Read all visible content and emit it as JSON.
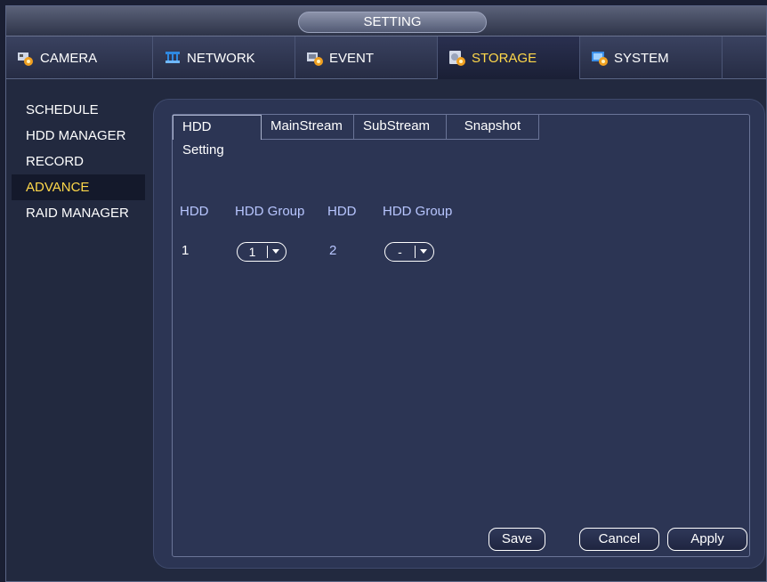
{
  "window": {
    "title": "SETTING"
  },
  "main_tabs": [
    {
      "label": "CAMERA",
      "icon": "camera-gear-icon"
    },
    {
      "label": "NETWORK",
      "icon": "network-icon"
    },
    {
      "label": "EVENT",
      "icon": "event-gear-icon"
    },
    {
      "label": "STORAGE",
      "icon": "storage-gear-icon",
      "active": true
    },
    {
      "label": "SYSTEM",
      "icon": "system-gear-icon"
    }
  ],
  "sidebar": {
    "items": [
      {
        "label": "SCHEDULE"
      },
      {
        "label": "HDD MANAGER"
      },
      {
        "label": "RECORD"
      },
      {
        "label": "ADVANCE",
        "active": true
      },
      {
        "label": "RAID MANAGER"
      }
    ]
  },
  "sub_tabs": [
    {
      "label": "HDD Setting",
      "active": true
    },
    {
      "label": "MainStream"
    },
    {
      "label": "SubStream"
    },
    {
      "label": "Snapshot"
    }
  ],
  "table": {
    "headers": [
      "HDD",
      "HDD Group",
      "HDD",
      "HDD Group"
    ],
    "rows": [
      {
        "hdd_a": "1",
        "group_a": "1",
        "hdd_b": "2",
        "group_b": "-"
      }
    ]
  },
  "buttons": {
    "save": "Save",
    "cancel": "Cancel",
    "apply": "Apply"
  },
  "colors": {
    "accent": "#ffd84a",
    "label": "#b8c6ff",
    "background": "#22293f"
  }
}
